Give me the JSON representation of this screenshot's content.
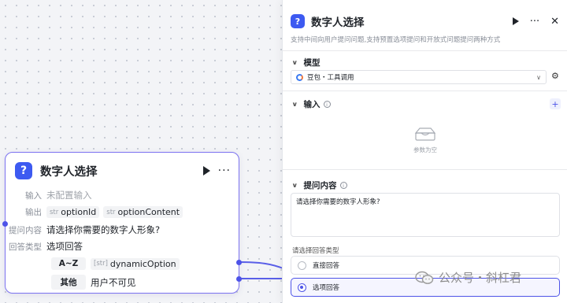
{
  "node": {
    "title": "数字人选择",
    "input_label": "输入",
    "input_value": "未配置输入",
    "output_label": "输出",
    "outputs": [
      {
        "type": "str",
        "name": "optionId"
      },
      {
        "type": "str",
        "name": "optionContent"
      }
    ],
    "question_label": "提问内容",
    "question_value": "请选择你需要的数字人形象?",
    "answer_type_label": "回答类型",
    "answer_type_value": "选项回答",
    "options": [
      {
        "tag": "A~Z",
        "type": "[str]",
        "value": "dynamicOption"
      },
      {
        "tag": "其他",
        "value": "用户不可见"
      }
    ]
  },
  "panel": {
    "title": "数字人选择",
    "description": "支持中间向用户提问问题,支持预置选项提问和开放式问题提问两种方式",
    "model_section": "模型",
    "model_value": "豆包・工具调用",
    "input_section": "输入",
    "empty_text": "参数为空",
    "question_section": "提问内容",
    "question_text": "请选择你需要的数字人形象?",
    "answer_type_label": "请选择回答类型",
    "answer_options": [
      {
        "label": "直接回答",
        "selected": false
      },
      {
        "label": "选项回答",
        "selected": true
      }
    ],
    "close_symbol": "✕",
    "more_symbol": "···"
  },
  "watermark": {
    "text": "公众号・斜杠君"
  },
  "colors": {
    "accent": "#4d53e8",
    "node_border": "#7b72f0",
    "question_icon": "#3d5af1"
  }
}
